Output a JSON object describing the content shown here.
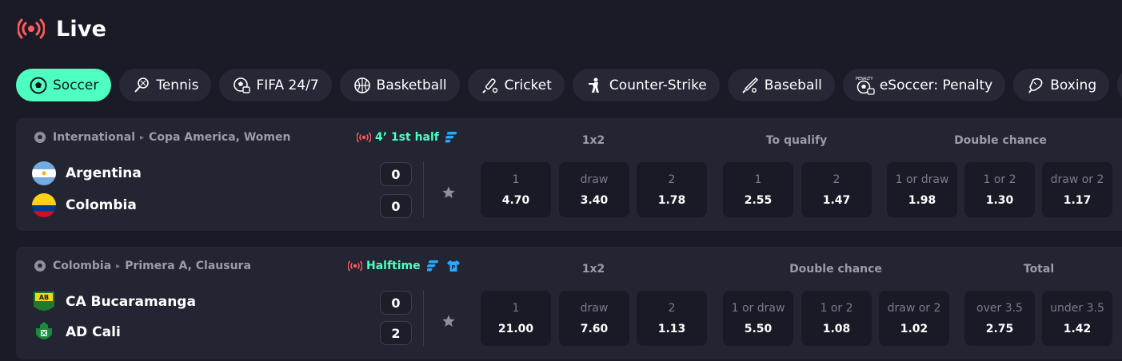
{
  "header": {
    "title": "Live"
  },
  "tabs": [
    {
      "label": "Soccer",
      "icon": "soccer-ball-icon",
      "active": true
    },
    {
      "label": "Tennis",
      "icon": "tennis-racket-icon"
    },
    {
      "label": "FIFA 24/7",
      "icon": "fifa-ball-icon"
    },
    {
      "label": "Basketball",
      "icon": "basketball-icon"
    },
    {
      "label": "Cricket",
      "icon": "cricket-bat-icon"
    },
    {
      "label": "Counter-Strike",
      "icon": "soldier-icon"
    },
    {
      "label": "Baseball",
      "icon": "baseball-bat-icon"
    },
    {
      "label": "eSoccer: Penalty",
      "icon": "esoccer-penalty-icon",
      "badge": "PENALTY"
    },
    {
      "label": "Boxing",
      "icon": "boxing-glove-icon"
    }
  ],
  "matches": [
    {
      "league": {
        "country": "International",
        "name": "Copa America, Women"
      },
      "status": "4’ 1st half",
      "teams": [
        {
          "name": "Argentina",
          "score": "0",
          "icon": "argentina-flag-icon"
        },
        {
          "name": "Colombia",
          "score": "0",
          "icon": "colombia-flag-icon"
        }
      ],
      "markets": [
        {
          "title": "1x2",
          "odds": [
            {
              "label": "1",
              "value": "4.70"
            },
            {
              "label": "draw",
              "value": "3.40"
            },
            {
              "label": "2",
              "value": "1.78"
            }
          ]
        },
        {
          "title": "To qualify",
          "odds": [
            {
              "label": "1",
              "value": "2.55"
            },
            {
              "label": "2",
              "value": "1.47"
            }
          ]
        },
        {
          "title": "Double chance",
          "odds": [
            {
              "label": "1 or draw",
              "value": "1.98"
            },
            {
              "label": "1 or 2",
              "value": "1.30"
            },
            {
              "label": "draw or 2",
              "value": "1.17"
            }
          ]
        }
      ]
    },
    {
      "league": {
        "country": "Colombia",
        "name": "Primera A, Clausura"
      },
      "status": "Halftime",
      "teams": [
        {
          "name": "CA Bucaramanga",
          "score": "0",
          "icon": "bucaramanga-crest-icon",
          "crest_text": "AB"
        },
        {
          "name": "AD Cali",
          "score": "2",
          "icon": "cali-crest-icon"
        }
      ],
      "markets": [
        {
          "title": "1x2",
          "odds": [
            {
              "label": "1",
              "value": "21.00"
            },
            {
              "label": "draw",
              "value": "7.60"
            },
            {
              "label": "2",
              "value": "1.13"
            }
          ]
        },
        {
          "title": "Double chance",
          "odds": [
            {
              "label": "1 or draw",
              "value": "5.50"
            },
            {
              "label": "1 or 2",
              "value": "1.08"
            },
            {
              "label": "draw or 2",
              "value": "1.02"
            }
          ]
        },
        {
          "title": "Total",
          "odds": [
            {
              "label": "over 3.5",
              "value": "2.75"
            },
            {
              "label": "under 3.5",
              "value": "1.42"
            }
          ]
        }
      ]
    }
  ],
  "colors": {
    "accent": "#4dffc1",
    "live_red": "#ff5a5f",
    "background": "#1a1b26",
    "card": "#232533",
    "odd_box": "#191a25",
    "info_blue": "#2aa7ff"
  }
}
